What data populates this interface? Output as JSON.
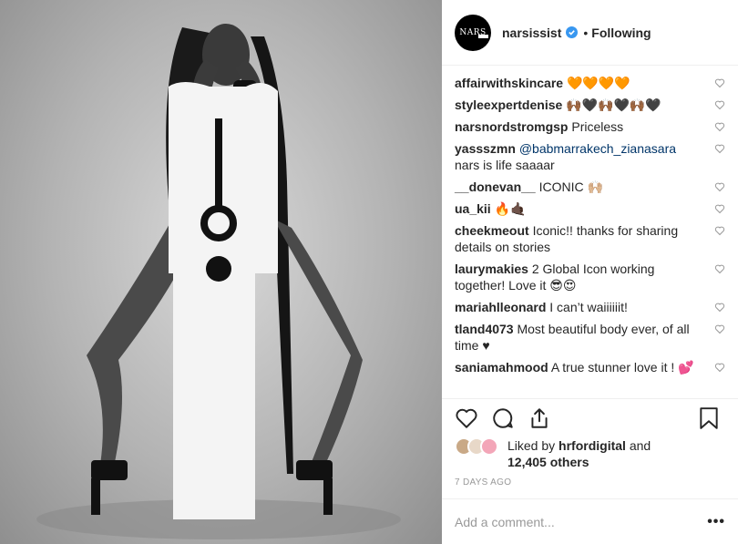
{
  "post": {
    "username": "narsissist",
    "avatar_text": "NARS",
    "follow_status": "Following",
    "separator": "•",
    "photo_desc_icon": "photo"
  },
  "comments": [
    {
      "user": "affairwithskincare",
      "text": "🧡🧡🧡🧡"
    },
    {
      "user": "styleexpertdenise",
      "text": "🙌🏾🖤🙌🏾🖤🙌🏾🖤"
    },
    {
      "user": "narsnordstromgsp",
      "text": "Priceless"
    },
    {
      "user": "yassszmn",
      "mention": "@babmarrakech_zianasara",
      "text": "nars is life saaaar"
    },
    {
      "user": "__donevan__",
      "text": "ICONIC 🙌🏼"
    },
    {
      "user": "ua_kii",
      "text": "🔥🤙🏿"
    },
    {
      "user": "cheekmeout",
      "text": "Iconic!! thanks for sharing details on stories"
    },
    {
      "user": "laurymakies",
      "text": "2 Global Icon working together! Love it 😎😍"
    },
    {
      "user": "mariahlleonard",
      "text": "I can’t waiiiiiit!"
    },
    {
      "user": "tland4073",
      "text": "Most beautiful body ever, of all time ♥"
    },
    {
      "user": "saniamahmood",
      "text": "A true stunner love it ! 💕"
    }
  ],
  "likes": {
    "prefix": "Liked by",
    "user": "hrfordigital",
    "and": "and",
    "count": "12,405 others"
  },
  "timestamp": "7 DAYS AGO",
  "add_comment": {
    "placeholder": "Add a comment...",
    "more": "•••"
  },
  "colors": {
    "verified": "#3897f0",
    "mention": "#003569",
    "muted": "#999999"
  }
}
